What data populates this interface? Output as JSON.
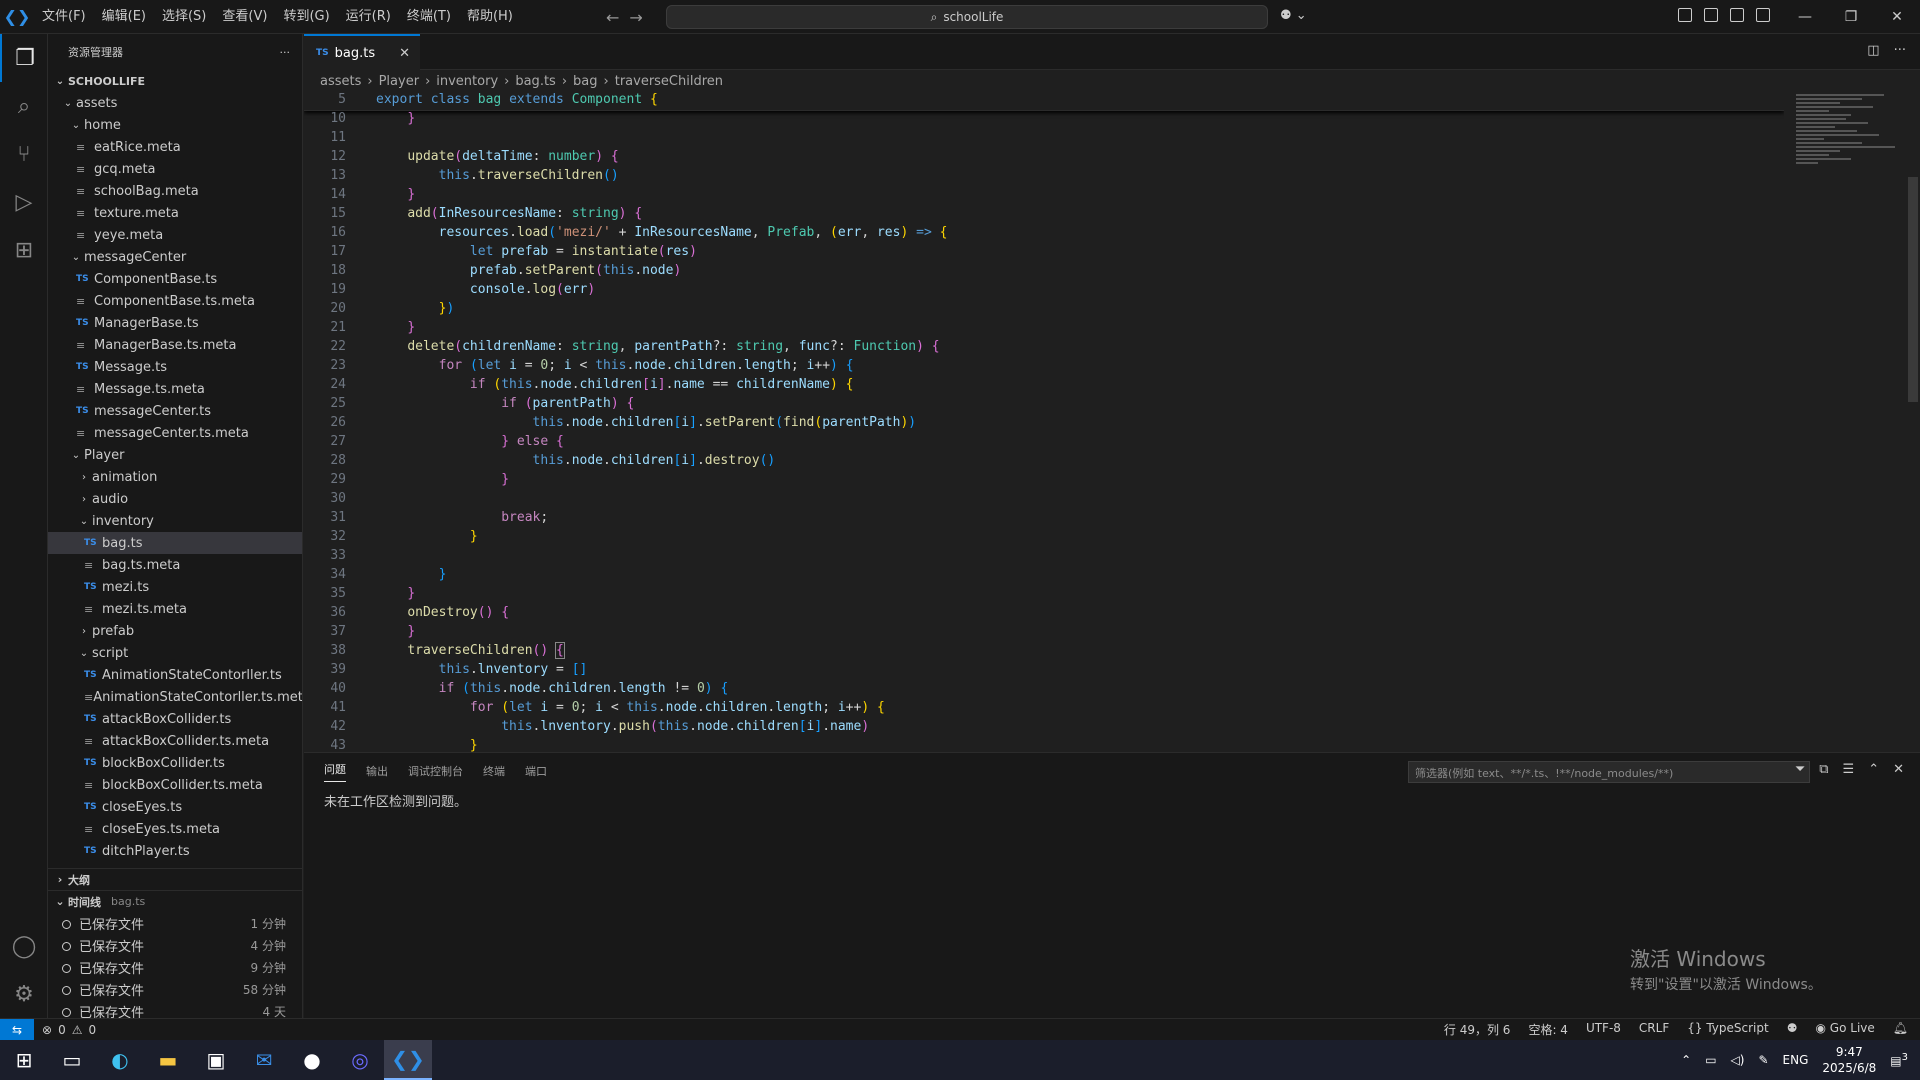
{
  "menu": [
    "文件(F)",
    "编辑(E)",
    "选择(S)",
    "查看(V)",
    "转到(G)",
    "运行(R)",
    "终端(T)",
    "帮助(H)"
  ],
  "search": {
    "label": "schoolLife"
  },
  "explorer": {
    "title": "资源管理器",
    "root": "SCHOOLLIFE",
    "rows": [
      {
        "label": "assets",
        "indent": 1,
        "chev": "v",
        "kind": "folder"
      },
      {
        "label": "home",
        "indent": 2,
        "chev": "v",
        "kind": "folder"
      },
      {
        "label": "eatRice.meta",
        "indent": 3,
        "kind": "meta"
      },
      {
        "label": "gcq.meta",
        "indent": 3,
        "kind": "meta"
      },
      {
        "label": "schoolBag.meta",
        "indent": 3,
        "kind": "meta"
      },
      {
        "label": "texture.meta",
        "indent": 3,
        "kind": "meta"
      },
      {
        "label": "yeye.meta",
        "indent": 3,
        "kind": "meta"
      },
      {
        "label": "messageCenter",
        "indent": 2,
        "chev": "v",
        "kind": "folder"
      },
      {
        "label": "ComponentBase.ts",
        "indent": 3,
        "kind": "ts"
      },
      {
        "label": "ComponentBase.ts.meta",
        "indent": 3,
        "kind": "meta"
      },
      {
        "label": "ManagerBase.ts",
        "indent": 3,
        "kind": "ts"
      },
      {
        "label": "ManagerBase.ts.meta",
        "indent": 3,
        "kind": "meta"
      },
      {
        "label": "Message.ts",
        "indent": 3,
        "kind": "ts"
      },
      {
        "label": "Message.ts.meta",
        "indent": 3,
        "kind": "meta"
      },
      {
        "label": "messageCenter.ts",
        "indent": 3,
        "kind": "ts"
      },
      {
        "label": "messageCenter.ts.meta",
        "indent": 3,
        "kind": "meta"
      },
      {
        "label": "Player",
        "indent": 2,
        "chev": "v",
        "kind": "folder"
      },
      {
        "label": "animation",
        "indent": 3,
        "chev": ">",
        "kind": "folder"
      },
      {
        "label": "audio",
        "indent": 3,
        "chev": ">",
        "kind": "folder"
      },
      {
        "label": "inventory",
        "indent": 3,
        "chev": "v",
        "kind": "folder"
      },
      {
        "label": "bag.ts",
        "indent": 4,
        "kind": "ts",
        "selected": true
      },
      {
        "label": "bag.ts.meta",
        "indent": 4,
        "kind": "meta"
      },
      {
        "label": "mezi.ts",
        "indent": 4,
        "kind": "ts"
      },
      {
        "label": "mezi.ts.meta",
        "indent": 4,
        "kind": "meta"
      },
      {
        "label": "prefab",
        "indent": 3,
        "chev": ">",
        "kind": "folder"
      },
      {
        "label": "script",
        "indent": 3,
        "chev": "v",
        "kind": "folder"
      },
      {
        "label": "AnimationStateContorller.ts",
        "indent": 4,
        "kind": "ts"
      },
      {
        "label": "AnimationStateContorller.ts.meta",
        "indent": 4,
        "kind": "meta"
      },
      {
        "label": "attackBoxCollider.ts",
        "indent": 4,
        "kind": "ts"
      },
      {
        "label": "attackBoxCollider.ts.meta",
        "indent": 4,
        "kind": "meta"
      },
      {
        "label": "blockBoxCollider.ts",
        "indent": 4,
        "kind": "ts"
      },
      {
        "label": "blockBoxCollider.ts.meta",
        "indent": 4,
        "kind": "meta"
      },
      {
        "label": "closeEyes.ts",
        "indent": 4,
        "kind": "ts"
      },
      {
        "label": "closeEyes.ts.meta",
        "indent": 4,
        "kind": "meta"
      },
      {
        "label": "ditchPlayer.ts",
        "indent": 4,
        "kind": "ts"
      }
    ],
    "outline": "大纲",
    "timeline": {
      "title": "时间线",
      "file": "bag.ts",
      "items": [
        {
          "label": "已保存文件",
          "time": "1 分钟"
        },
        {
          "label": "已保存文件",
          "time": "4 分钟"
        },
        {
          "label": "已保存文件",
          "time": "9 分钟"
        },
        {
          "label": "已保存文件",
          "time": "58 分钟"
        },
        {
          "label": "已保存文件",
          "time": "4 天"
        },
        {
          "label": "已保存文件",
          "time": ""
        }
      ]
    }
  },
  "tab": {
    "label": "bag.ts"
  },
  "breadcrumb": [
    "assets",
    "Player",
    "inventory",
    "bag.ts",
    "bag",
    "traverseChildren"
  ],
  "code": {
    "sticky": {
      "n": "5",
      "html": "<span class='kw'>export</span> <span class='kw'>class</span> <span class='ty'>bag</span> <span class='kw'>extends</span> <span class='ty'>Component</span> <span class='br1'>{</span>"
    },
    "lines": [
      {
        "n": "10",
        "html": "    <span class='br2'>}</span>"
      },
      {
        "n": "11",
        "html": ""
      },
      {
        "n": "12",
        "html": "    <span class='fn'>update</span><span class='br2'>(</span><span class='vr'>deltaTime</span>: <span class='ty'>number</span><span class='br2'>)</span> <span class='br2'>{</span>"
      },
      {
        "n": "13",
        "html": "        <span class='kw'>this</span>.<span class='fn'>traverseChildren</span><span class='br3'>()</span>"
      },
      {
        "n": "14",
        "html": "    <span class='br2'>}</span>"
      },
      {
        "n": "15",
        "html": "    <span class='fn'>add</span><span class='br2'>(</span><span class='vr'>InResourcesName</span>: <span class='ty'>string</span><span class='br2'>)</span> <span class='br2'>{</span>"
      },
      {
        "n": "16",
        "html": "        <span class='vr'>resources</span>.<span class='fn'>load</span><span class='br3'>(</span><span class='st'>'mezi/'</span> + <span class='vr'>InResourcesName</span>, <span class='ty'>Prefab</span>, <span class='br1'>(</span><span class='vr'>err</span>, <span class='vr'>res</span><span class='br1'>)</span> <span class='kw'>=&gt;</span> <span class='br1'>{</span>"
      },
      {
        "n": "17",
        "html": "            <span class='kw'>let</span> <span class='vr'>prefab</span> = <span class='fn'>instantiate</span><span class='br2'>(</span><span class='vr'>res</span><span class='br2'>)</span>"
      },
      {
        "n": "18",
        "html": "            <span class='vr'>prefab</span>.<span class='fn'>setParent</span><span class='br2'>(</span><span class='kw'>this</span>.<span class='vr'>node</span><span class='br2'>)</span>"
      },
      {
        "n": "19",
        "html": "            <span class='vr'>console</span>.<span class='fn'>log</span><span class='br2'>(</span><span class='vr'>err</span><span class='br2'>)</span>"
      },
      {
        "n": "20",
        "html": "        <span class='br1'>}</span><span class='br3'>)</span>"
      },
      {
        "n": "21",
        "html": "    <span class='br2'>}</span>"
      },
      {
        "n": "22",
        "html": "    <span class='fn'>delete</span><span class='br2'>(</span><span class='vr'>childrenName</span>: <span class='ty'>string</span>, <span class='vr'>parentPath</span>?: <span class='ty'>string</span>, <span class='vr'>func</span>?: <span class='ty'>Function</span><span class='br2'>)</span> <span class='br2'>{</span>"
      },
      {
        "n": "23",
        "html": "        <span class='kw2'>for</span> <span class='br3'>(</span><span class='kw'>let</span> <span class='vr'>i</span> = <span class='nm'>0</span>; <span class='vr'>i</span> &lt; <span class='kw'>this</span>.<span class='vr'>node</span>.<span class='vr'>children</span>.<span class='vr'>length</span>; <span class='vr'>i</span>++<span class='br3'>)</span> <span class='br3'>{</span>"
      },
      {
        "n": "24",
        "html": "            <span class='kw2'>if</span> <span class='br1'>(</span><span class='kw'>this</span>.<span class='vr'>node</span>.<span class='vr'>children</span><span class='br2'>[</span><span class='vr'>i</span><span class='br2'>]</span>.<span class='vr'>name</span> == <span class='vr'>childrenName</span><span class='br1'>)</span> <span class='br1'>{</span>"
      },
      {
        "n": "25",
        "html": "                <span class='kw2'>if</span> <span class='br2'>(</span><span class='vr'>parentPath</span><span class='br2'>)</span> <span class='br2'>{</span>"
      },
      {
        "n": "26",
        "html": "                    <span class='kw'>this</span>.<span class='vr'>node</span>.<span class='vr'>children</span><span class='br3'>[</span><span class='vr'>i</span><span class='br3'>]</span>.<span class='fn'>setParent</span><span class='br3'>(</span><span class='fn'>find</span><span class='br1'>(</span><span class='vr'>parentPath</span><span class='br1'>)</span><span class='br3'>)</span>"
      },
      {
        "n": "27",
        "html": "                <span class='br2'>}</span> <span class='kw2'>else</span> <span class='br2'>{</span>"
      },
      {
        "n": "28",
        "html": "                    <span class='kw'>this</span>.<span class='vr'>node</span>.<span class='vr'>children</span><span class='br3'>[</span><span class='vr'>i</span><span class='br3'>]</span>.<span class='fn'>destroy</span><span class='br3'>()</span>"
      },
      {
        "n": "29",
        "html": "                <span class='br2'>}</span>"
      },
      {
        "n": "30",
        "html": ""
      },
      {
        "n": "31",
        "html": "                <span class='kw2'>break</span>;"
      },
      {
        "n": "32",
        "html": "            <span class='br1'>}</span>"
      },
      {
        "n": "33",
        "html": ""
      },
      {
        "n": "34",
        "html": "        <span class='br3'>}</span>"
      },
      {
        "n": "35",
        "html": "    <span class='br2'>}</span>"
      },
      {
        "n": "36",
        "html": "    <span class='fn'>onDestroy</span><span class='br2'>()</span> <span class='br2'>{</span>"
      },
      {
        "n": "37",
        "html": "    <span class='br2'>}</span>"
      },
      {
        "n": "38",
        "html": "    <span class='fn'>traverseChildren</span><span class='br2'>()</span> <span class='br2' style='outline:1px solid #888'>{</span>"
      },
      {
        "n": "39",
        "html": "        <span class='kw'>this</span>.<span class='vr'>lnventory</span> = <span class='br3'>[]</span>"
      },
      {
        "n": "40",
        "html": "        <span class='kw2'>if</span> <span class='br3'>(</span><span class='kw'>this</span>.<span class='vr'>node</span>.<span class='vr'>children</span>.<span class='vr'>length</span> != <span class='nm'>0</span><span class='br3'>)</span> <span class='br3'>{</span>"
      },
      {
        "n": "41",
        "html": "            <span class='kw2'>for</span> <span class='br1'>(</span><span class='kw'>let</span> <span class='vr'>i</span> = <span class='nm'>0</span>; <span class='vr'>i</span> &lt; <span class='kw'>this</span>.<span class='vr'>node</span>.<span class='vr'>children</span>.<span class='vr'>length</span>; <span class='vr'>i</span>++<span class='br1'>)</span> <span class='br1'>{</span>"
      },
      {
        "n": "42",
        "html": "                <span class='kw'>this</span>.<span class='vr'>lnventory</span>.<span class='fn'>push</span><span class='br2'>(</span><span class='kw'>this</span>.<span class='vr'>node</span>.<span class='vr'>children</span><span class='br3'>[</span><span class='vr'>i</span><span class='br3'>]</span>.<span class='vr'>name</span><span class='br2'>)</span>"
      },
      {
        "n": "43",
        "html": "            <span class='br1'>}</span>"
      }
    ]
  },
  "panel": {
    "tabs": [
      "问题",
      "输出",
      "调试控制台",
      "终端",
      "端口"
    ],
    "filter_placeholder": "筛选器(例如 text、**/*.ts、!**/node_modules/**)",
    "message": "未在工作区检测到问题。"
  },
  "watermark": {
    "line1": "激活 Windows",
    "line2": "转到\"设置\"以激活 Windows。"
  },
  "status": {
    "errors": "0",
    "warnings": "0",
    "position": "行 49，列 6",
    "spaces": "空格: 4",
    "encoding": "UTF-8",
    "eol": "CRLF",
    "language": "TypeScript",
    "golive": "Go Live"
  },
  "taskbar": {
    "lang": "ENG",
    "time": "9:47",
    "date": "2025/6/8",
    "notif": "3"
  }
}
